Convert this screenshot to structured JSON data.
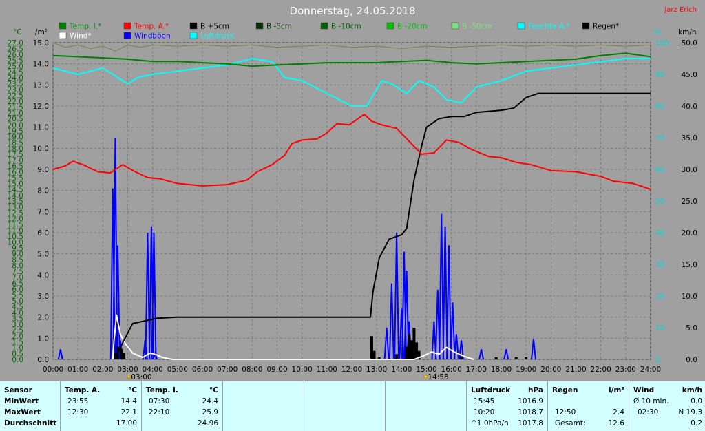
{
  "title": "Donnerstag, 24.05.2018",
  "credit": "Jarz Erich",
  "axis_units": {
    "left_c": "°C",
    "left_lm2": "l/m²",
    "right_pct": "%",
    "right_kmh": "km/h"
  },
  "legend": [
    {
      "label": "Temp. I.*",
      "color": "#008000"
    },
    {
      "label": "Temp. A.*",
      "color": "#ff0000"
    },
    {
      "label": "B +5cm",
      "color": "#000000"
    },
    {
      "label": "B -5cm",
      "color": "#003000"
    },
    {
      "label": "B -10cm",
      "color": "#006000"
    },
    {
      "label": "B -20cm",
      "color": "#00c000"
    },
    {
      "label": "B -50cm",
      "color": "#80e080"
    },
    {
      "label": "Feuchte A.*",
      "color": "#00ffff"
    },
    {
      "label": "Regen*",
      "color": "#000000"
    },
    {
      "label": "Wind*",
      "color": "#ffffff"
    },
    {
      "label": "Windböen",
      "color": "#0000ff"
    },
    {
      "label": "Luftdruck",
      "color": "#00ffff"
    }
  ],
  "markers": [
    {
      "time": 3.05,
      "label": "03:00"
    },
    {
      "time": 14.97,
      "label": "14:58"
    }
  ],
  "chart_data": {
    "type": "line",
    "xlim": [
      0,
      24
    ],
    "x_ticks": [
      "00:00",
      "01:00",
      "02:00",
      "03:00",
      "04:00",
      "05:00",
      "06:00",
      "07:00",
      "08:00",
      "09:00",
      "10:00",
      "11:00",
      "12:00",
      "13:00",
      "14:00",
      "15:00",
      "16:00",
      "17:00",
      "18:00",
      "19:00",
      "20:00",
      "21:00",
      "22:00",
      "23:00",
      "24:00"
    ],
    "temp_axis": {
      "lim": [
        0,
        27
      ],
      "ticks": [
        "0.0",
        "0.5",
        "1.0",
        "1.5",
        "2.0",
        "2.5",
        "3.0",
        "3.5",
        "4.0",
        "4.5",
        "5.0",
        "5.5",
        "6.0",
        "6.5",
        "7.0",
        "7.5",
        "8.0",
        "8.5",
        "9.0",
        "9.5",
        "10.0",
        "10.5",
        "11.0",
        "11.5",
        "12.0",
        "12.5",
        "13.0",
        "13.5",
        "14.0",
        "14.5",
        "15.0",
        "15.5",
        "16.0",
        "16.5",
        "17.0",
        "17.5",
        "18.0",
        "18.5",
        "19.0",
        "19.5",
        "20.0",
        "20.5",
        "21.0",
        "21.5",
        "22.0",
        "22.5",
        "23.0",
        "23.5",
        "24.0",
        "24.5",
        "25.0",
        "25.5",
        "26.0",
        "26.5",
        "27.0"
      ]
    },
    "rain_axis": {
      "lim": [
        0,
        15
      ],
      "ticks": [
        "0.0",
        "1.0",
        "2.0",
        "3.0",
        "4.0",
        "5.0",
        "6.0",
        "7.0",
        "8.0",
        "9.0",
        "10.0",
        "11.0",
        "12.0",
        "13.0",
        "14.0",
        "15.0"
      ]
    },
    "humidity_axis": {
      "lim": [
        0,
        100
      ],
      "ticks": [
        "0",
        "10",
        "20",
        "30",
        "40",
        "50",
        "60",
        "70",
        "80",
        "90",
        "100"
      ]
    },
    "wind_axis": {
      "lim": [
        0,
        50
      ],
      "ticks": [
        "0.0",
        "5.0",
        "10.0",
        "15.0",
        "20.0",
        "25.0",
        "30.0",
        "35.0",
        "40.0",
        "45.0",
        "50.0"
      ]
    },
    "series": [
      {
        "name": "Temp. I.*",
        "axis": "temp",
        "color": "#008000",
        "points": [
          [
            0,
            25.9
          ],
          [
            1,
            25.8
          ],
          [
            2,
            25.7
          ],
          [
            3,
            25.6
          ],
          [
            4,
            25.4
          ],
          [
            5,
            25.4
          ],
          [
            6,
            25.3
          ],
          [
            7,
            25.2
          ],
          [
            8,
            25.0
          ],
          [
            9,
            25.1
          ],
          [
            10,
            25.2
          ],
          [
            11,
            25.3
          ],
          [
            12,
            25.3
          ],
          [
            13,
            25.3
          ],
          [
            14,
            25.4
          ],
          [
            15,
            25.5
          ],
          [
            16,
            25.3
          ],
          [
            17,
            25.2
          ],
          [
            18,
            25.3
          ],
          [
            19,
            25.4
          ],
          [
            20,
            25.5
          ],
          [
            21,
            25.6
          ],
          [
            22,
            25.9
          ],
          [
            23,
            26.1
          ],
          [
            24,
            25.8
          ]
        ]
      },
      {
        "name": "Temp. A.*",
        "axis": "temp",
        "color": "#ff0000",
        "points": [
          [
            0,
            16.2
          ],
          [
            0.5,
            16.5
          ],
          [
            0.8,
            16.9
          ],
          [
            1.2,
            16.6
          ],
          [
            1.8,
            16.0
          ],
          [
            2.3,
            15.9
          ],
          [
            2.8,
            16.6
          ],
          [
            3.3,
            16.0
          ],
          [
            3.8,
            15.5
          ],
          [
            4.3,
            15.4
          ],
          [
            5,
            15.0
          ],
          [
            6,
            14.8
          ],
          [
            7,
            14.9
          ],
          [
            7.8,
            15.3
          ],
          [
            8.2,
            16.0
          ],
          [
            8.8,
            16.6
          ],
          [
            9.3,
            17.4
          ],
          [
            9.6,
            18.4
          ],
          [
            10,
            18.7
          ],
          [
            10.6,
            18.8
          ],
          [
            11,
            19.3
          ],
          [
            11.4,
            20.1
          ],
          [
            11.9,
            20.0
          ],
          [
            12.5,
            20.9
          ],
          [
            12.8,
            20.3
          ],
          [
            13.2,
            20.0
          ],
          [
            13.8,
            19.7
          ],
          [
            14.3,
            18.6
          ],
          [
            14.8,
            17.5
          ],
          [
            15.3,
            17.6
          ],
          [
            15.8,
            18.7
          ],
          [
            16.3,
            18.5
          ],
          [
            16.8,
            17.9
          ],
          [
            17.5,
            17.3
          ],
          [
            18,
            17.2
          ],
          [
            18.6,
            16.8
          ],
          [
            19.2,
            16.6
          ],
          [
            20,
            16.1
          ],
          [
            21,
            16.0
          ],
          [
            22,
            15.6
          ],
          [
            22.5,
            15.2
          ],
          [
            23.3,
            15.0
          ],
          [
            24,
            14.5
          ]
        ]
      },
      {
        "name": "Feuchte A.*",
        "axis": "humidity",
        "color": "#00ffff",
        "points": [
          [
            0,
            92
          ],
          [
            1,
            90
          ],
          [
            2,
            92
          ],
          [
            2.6,
            89
          ],
          [
            3.0,
            87
          ],
          [
            3.4,
            89
          ],
          [
            4,
            90
          ],
          [
            5,
            91
          ],
          [
            6,
            92
          ],
          [
            7,
            93
          ],
          [
            8,
            95
          ],
          [
            8.8,
            94
          ],
          [
            9.3,
            89
          ],
          [
            10,
            88
          ],
          [
            11,
            84
          ],
          [
            12,
            80
          ],
          [
            12.6,
            80
          ],
          [
            13.2,
            88
          ],
          [
            13.6,
            87
          ],
          [
            14.2,
            84
          ],
          [
            14.7,
            88
          ],
          [
            15.3,
            86
          ],
          [
            15.8,
            82
          ],
          [
            16.4,
            81
          ],
          [
            17,
            86
          ],
          [
            18,
            88
          ],
          [
            19,
            91
          ],
          [
            20,
            92
          ],
          [
            21,
            93
          ],
          [
            22,
            94
          ],
          [
            23,
            95
          ],
          [
            24,
            95
          ]
        ]
      },
      {
        "name": "Regen*",
        "axis": "rain",
        "color": "#000000",
        "points": [
          [
            2.5,
            0
          ],
          [
            2.8,
            0.8
          ],
          [
            3.2,
            1.7
          ],
          [
            3.6,
            1.8
          ],
          [
            4.2,
            1.95
          ],
          [
            5,
            2.0
          ],
          [
            8,
            2.0
          ],
          [
            11,
            2.0
          ],
          [
            12.75,
            2.0
          ],
          [
            12.85,
            3.2
          ],
          [
            13.1,
            4.8
          ],
          [
            13.5,
            5.7
          ],
          [
            14,
            5.9
          ],
          [
            14.2,
            6.2
          ],
          [
            14.5,
            8.5
          ],
          [
            14.8,
            10.1
          ],
          [
            15,
            11.0
          ],
          [
            15.5,
            11.4
          ],
          [
            16,
            11.5
          ],
          [
            16.5,
            11.5
          ],
          [
            17,
            11.7
          ],
          [
            18,
            11.8
          ],
          [
            18.5,
            11.9
          ],
          [
            19,
            12.4
          ],
          [
            19.5,
            12.6
          ],
          [
            24,
            12.6
          ]
        ]
      },
      {
        "name": "Wind*",
        "axis": "wind",
        "color": "#ffffff",
        "points": [
          [
            2.4,
            0
          ],
          [
            2.45,
            3.0
          ],
          [
            2.55,
            7.0
          ],
          [
            2.7,
            4.0
          ],
          [
            2.9,
            2.5
          ],
          [
            3.2,
            1.0
          ],
          [
            3.6,
            0.3
          ],
          [
            3.9,
            1.0
          ],
          [
            4.1,
            0.8
          ],
          [
            4.4,
            0.3
          ],
          [
            4.8,
            0
          ],
          [
            14.5,
            0
          ],
          [
            14.9,
            0.6
          ],
          [
            15.2,
            1.2
          ],
          [
            15.5,
            0.8
          ],
          [
            15.8,
            1.9
          ],
          [
            16.1,
            1.2
          ],
          [
            16.5,
            0.5
          ],
          [
            16.9,
            0
          ]
        ]
      },
      {
        "name": "Windböen",
        "axis": "wind",
        "color": "#0000ff",
        "bars": [
          [
            0.3,
            1.6
          ],
          [
            2.4,
            27
          ],
          [
            2.5,
            35
          ],
          [
            2.6,
            18
          ],
          [
            2.7,
            3
          ],
          [
            3.7,
            3
          ],
          [
            3.8,
            20
          ],
          [
            3.95,
            21
          ],
          [
            4.05,
            20
          ],
          [
            4.1,
            1
          ],
          [
            13.4,
            5
          ],
          [
            13.6,
            12
          ],
          [
            13.8,
            20
          ],
          [
            14.0,
            8
          ],
          [
            14.1,
            17
          ],
          [
            14.2,
            14
          ],
          [
            14.3,
            6
          ],
          [
            14.4,
            3
          ],
          [
            15.3,
            6
          ],
          [
            15.45,
            11
          ],
          [
            15.6,
            23
          ],
          [
            15.75,
            21
          ],
          [
            15.9,
            18
          ],
          [
            16.05,
            9
          ],
          [
            16.2,
            4
          ],
          [
            16.4,
            3
          ],
          [
            17.2,
            1.6
          ],
          [
            18.2,
            1.6
          ],
          [
            19.3,
            3.2
          ]
        ]
      },
      {
        "name": "Regen bars",
        "axis": "rain",
        "color": "#000000",
        "bars": [
          [
            2.5,
            0.3
          ],
          [
            2.6,
            0.6
          ],
          [
            2.75,
            0.5
          ],
          [
            2.85,
            0.3
          ],
          [
            12.8,
            1.1
          ],
          [
            12.9,
            0.4
          ],
          [
            13.1,
            0.1
          ],
          [
            13.8,
            0.25
          ],
          [
            14.2,
            0.6
          ],
          [
            14.3,
            1.2
          ],
          [
            14.4,
            0.9
          ],
          [
            14.5,
            1.5
          ],
          [
            14.6,
            0.8
          ],
          [
            14.7,
            0.4
          ],
          [
            16.4,
            0.15
          ],
          [
            17.8,
            0.1
          ],
          [
            18.6,
            0.1
          ],
          [
            19.0,
            0.1
          ]
        ]
      },
      {
        "name": "Luftdruck",
        "axis": "pressure",
        "color": "#7f7f40",
        "points": [
          [
            0,
            27.0
          ],
          [
            0.5,
            26.6
          ],
          [
            1,
            26.8
          ],
          [
            1.5,
            26.5
          ],
          [
            2,
            26.7
          ],
          [
            2.5,
            26.3
          ],
          [
            3,
            26.8
          ],
          [
            3.5,
            26.6
          ],
          [
            4,
            26.8
          ],
          [
            5,
            26.7
          ],
          [
            6,
            26.8
          ],
          [
            7,
            26.7
          ],
          [
            8,
            26.8
          ],
          [
            9,
            26.6
          ],
          [
            10,
            26.7
          ],
          [
            11,
            26.8
          ],
          [
            12,
            26.6
          ],
          [
            13,
            26.7
          ],
          [
            14,
            26.5
          ],
          [
            15,
            26.7
          ],
          [
            16,
            26.6
          ],
          [
            17,
            26.7
          ],
          [
            18,
            26.8
          ],
          [
            19,
            26.7
          ],
          [
            20,
            26.8
          ],
          [
            21,
            26.7
          ],
          [
            22,
            26.8
          ],
          [
            23,
            26.7
          ],
          [
            24,
            26.8
          ]
        ]
      }
    ]
  },
  "footer": {
    "sensor": {
      "head": "Sensor",
      "rows": [
        "MinWert",
        "MaxWert",
        "Durchschnitt"
      ]
    },
    "temp_a": {
      "head": "Temp. A.",
      "unit": "°C",
      "rows": [
        {
          "time": "23:55",
          "value": "14.4"
        },
        {
          "time": "12:30",
          "value": "22.1"
        },
        {
          "time": "",
          "value": "17.00"
        }
      ]
    },
    "temp_i": {
      "head": "Temp. I.",
      "unit": "°C",
      "rows": [
        {
          "time": "07:30",
          "value": "24.4"
        },
        {
          "time": "22:10",
          "value": "25.9"
        },
        {
          "time": "",
          "value": "24.96"
        }
      ]
    },
    "luftdruck": {
      "head": "Luftdruck",
      "unit": "hPa",
      "rows": [
        {
          "time": "15:45",
          "value": "1016.9"
        },
        {
          "time": "10:20",
          "value": "1018.7"
        },
        {
          "time": "^1.0hPa/h",
          "value": "1017.8"
        }
      ]
    },
    "regen": {
      "head": "Regen",
      "unit": "l/m²",
      "rows": [
        {
          "time": "",
          "value": ""
        },
        {
          "time": "12:50",
          "value": "2.4"
        },
        {
          "time": "Gesamt:",
          "value": "12.6"
        }
      ]
    },
    "wind": {
      "head": "Wind",
      "unit": "km/h",
      "rows": [
        {
          "time": "Ø 10 min.",
          "value": "0.0"
        },
        {
          "time": "02:30",
          "value": "N 19.3"
        },
        {
          "time": "",
          "value": "0.2"
        }
      ]
    }
  }
}
